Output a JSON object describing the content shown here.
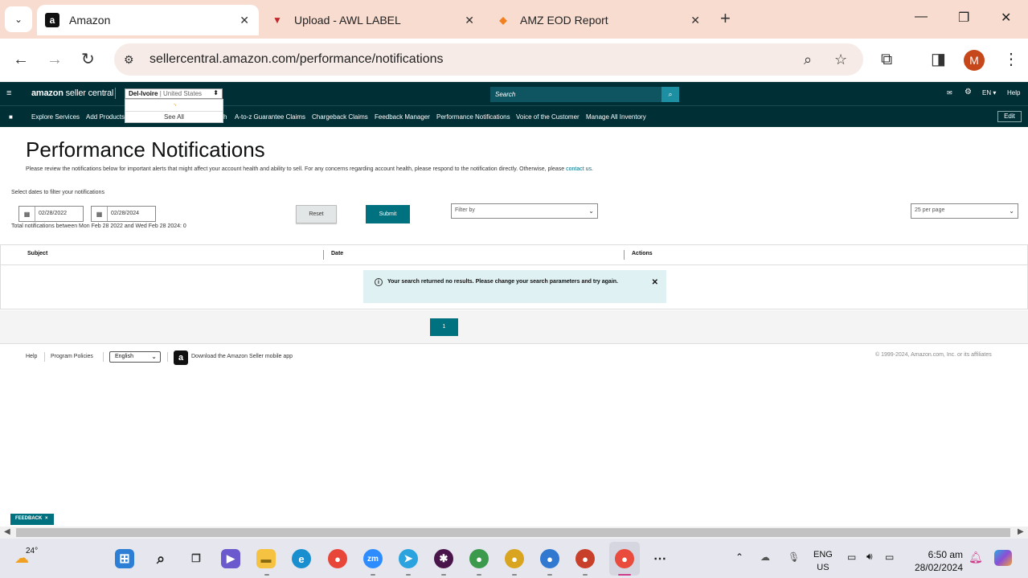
{
  "browser": {
    "tabs": [
      {
        "title": "Amazon",
        "favicon": "a",
        "active": true
      },
      {
        "title": "Upload - AWL LABEL",
        "favicon": "▼",
        "active": false
      },
      {
        "title": "AMZ EOD Report",
        "favicon": "◆",
        "active": false
      }
    ],
    "url": "sellercentral.amazon.com/performance/notifications",
    "profile_initial": "M"
  },
  "header": {
    "logo_bold": "amazon",
    "logo_rest": " seller central",
    "account_name": "Del-Ivoire",
    "account_region": " | United States",
    "account_dropdown_see_all": "See All",
    "search_placeholder": "Search",
    "language": "EN",
    "help": "Help"
  },
  "nav": {
    "items": [
      "Explore Services",
      "Add Products",
      "h",
      "A-to-z Guarantee Claims",
      "Chargeback Claims",
      "Feedback Manager",
      "Performance Notifications",
      "Voice of the Customer",
      "Manage All Inventory"
    ],
    "edit_label": "Edit"
  },
  "page": {
    "title": "Performance Notifications",
    "description": "Please review the notifications below for important alerts that might affect your account health and ability to sell. For any concerns regarding account health, please respond to the notification directly. Otherwise, please ",
    "contact_link": "contact us",
    "description_end": ".",
    "filter_label": "Select dates to filter your notifications",
    "date_from": "02/28/2022",
    "date_to": "02/28/2024",
    "reset_label": "Reset",
    "submit_label": "Submit",
    "filter_by_placeholder": "Filter by",
    "per_page": "25 per page",
    "total_text": "Total notifications between Mon Feb 28 2022 and Wed Feb 28 2024: 0"
  },
  "table": {
    "columns": [
      "Subject",
      "Date",
      "Actions"
    ],
    "alert_message": "Your search returned no results. Please change your search parameters and try again."
  },
  "pagination": {
    "current_page": "1"
  },
  "footer": {
    "help": "Help",
    "program_policies": "Program Policies",
    "language": "English",
    "download_app": "Download the Amazon Seller mobile app",
    "copyright": "© 1999-2024, Amazon.com, Inc. or its affiliates"
  },
  "feedback": {
    "label": "FEEDBACK",
    "close": "×"
  },
  "taskbar": {
    "weather_temp": "24°",
    "lang_line1": "ENG",
    "lang_line2": "US",
    "time": "6:50 am",
    "date": "28/02/2024"
  },
  "colors": {
    "seller_header": "#002f36",
    "teal_button": "#00727f",
    "tab_bar": "#f9dcd0"
  }
}
